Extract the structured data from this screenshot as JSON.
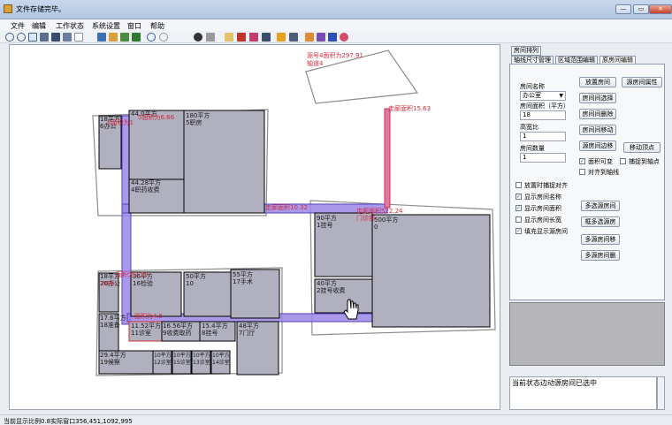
{
  "window": {
    "title": "文件存储完毕。",
    "min": "—",
    "max": "▭",
    "close": "✕"
  },
  "menu": [
    "文件",
    "编辑",
    "工作状态",
    "系统设置",
    "窗口",
    "帮助"
  ],
  "right_panel": {
    "tabs": [
      "房间排列",
      "轴线尺寸管理",
      "区域范围编辑",
      "原房间编辑"
    ],
    "active_tab_index": 3,
    "room_name_label": "房间名称",
    "room_name_value": "办公室",
    "room_area_label": "房间面积（平方）",
    "room_area_value": "18",
    "aspect_label": "高宽比",
    "aspect_value": "1",
    "room_count_label": "房间数量",
    "room_count_value": "1",
    "buttons": {
      "place_room": "放置房间",
      "room_props": "源房间属性",
      "room_select": "房间间选择",
      "room_delete": "房间间删除",
      "room_move": "房间间移动",
      "room_edge_move": "源房间边移",
      "move_vertex": "移动顶点",
      "multi_select": "多选源房间",
      "frame_multi_select": "框多选源房",
      "multi_move": "多源房间移",
      "multi_delete": "多源房间删"
    },
    "checks": {
      "area_variable": {
        "label": "面积可变",
        "checked": true
      },
      "snap_axis": {
        "label": "捕捉到轴点",
        "checked": false
      },
      "align_axis": {
        "label": "对齐到轴线",
        "checked": false
      },
      "snap_on_place": {
        "label": "放置时捕捉对齐",
        "checked": false
      },
      "show_name": {
        "label": "显示房间名称",
        "checked": true
      },
      "show_area": {
        "label": "显示房间面积",
        "checked": true
      },
      "show_length": {
        "label": "显示房间长宽",
        "checked": false
      },
      "fill_show": {
        "label": "填充显示源房间",
        "checked": true
      }
    }
  },
  "status_message": "当前状态边动源房间已选中",
  "status_bar": "当前显示比例0.8实际窗口356,451,1092,995",
  "canvas": {
    "rooms": [
      {
        "l1": "180平方",
        "l2": "5职房"
      },
      {
        "l1": "44.28平方",
        "l2": "4职药收费"
      },
      {
        "l1": "90平方",
        "l2": "1挂号"
      },
      {
        "l1": "40平方",
        "l2": "2挂号收费"
      },
      {
        "l1": "500平方",
        "l2": "0"
      },
      {
        "l1": "36平方",
        "l2": "16检验"
      },
      {
        "l1": "50平方",
        "l2": "10"
      },
      {
        "l1": "55平方",
        "l2": "17手术"
      },
      {
        "l1": "17.6平方",
        "l2": "18准备"
      },
      {
        "l1": "11.52平方",
        "l2": "11诊室"
      },
      {
        "l1": "16.56平方",
        "l2": "9收费取药"
      },
      {
        "l1": "15.4平方",
        "l2": "8挂号"
      },
      {
        "l1": "48平方",
        "l2": "7门厅"
      },
      {
        "l1": "29.4平方",
        "l2": "19候察"
      },
      {
        "l1": "10平方",
        "l2": "12诊室"
      },
      {
        "l1": "10平方",
        "l2": "15诊室"
      },
      {
        "l1": "10平方",
        "l2": "13诊室"
      },
      {
        "l1": "10平方",
        "l2": "14诊室"
      },
      {
        "l1": "18平方",
        "l2": "6办公"
      },
      {
        "l1": "18平方",
        "l2": "20办公"
      },
      {
        "l1": "44.0平方",
        "l2": ""
      }
    ],
    "red_labels": {
      "top_block": "源号4面积为297.91",
      "top_block2": "轴道4",
      "vert_corridor": "走廊面积15.63",
      "horiz_corridor_a": "走廊面积10.32",
      "horiz_corridor_b": "走廊面积522.24",
      "door": "门诊部",
      "left_area": "5面积为6.66",
      "left_low": "面积为2.59",
      "left_low2": "6面积为1",
      "mid_low": "面积为4.5",
      "room_tag": "20号"
    }
  },
  "colors": {
    "room_fill": "#b0b0bf",
    "corridor_fill": "#9b86e6",
    "corridor_red": "#e0527a",
    "outline": "#000000"
  }
}
